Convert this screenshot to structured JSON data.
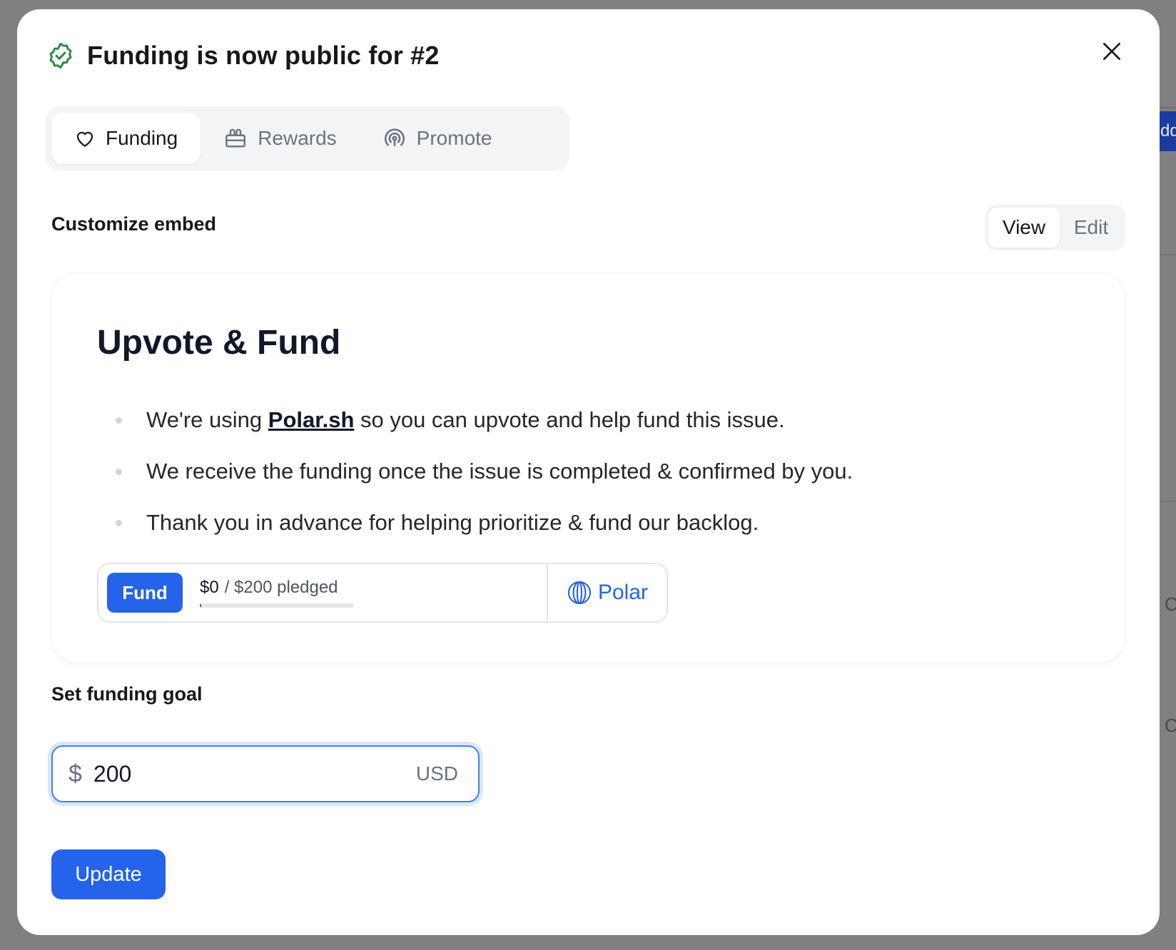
{
  "header": {
    "title": "Funding is now public for #2",
    "status_icon": "check-badge-icon",
    "close_icon": "close-icon"
  },
  "tabs": [
    {
      "label": "Funding",
      "icon": "heart-icon",
      "active": true
    },
    {
      "label": "Rewards",
      "icon": "gift-icon",
      "active": false
    },
    {
      "label": "Promote",
      "icon": "broadcast-icon",
      "active": false
    }
  ],
  "embed": {
    "section_title": "Customize embed",
    "toggle": {
      "view_label": "View",
      "edit_label": "Edit",
      "selected": "View"
    },
    "preview": {
      "heading": "Upvote & Fund",
      "bullet1_pre": "We're using ",
      "bullet1_link": "Polar.sh",
      "bullet1_post": " so you can upvote and help fund this issue.",
      "bullet2": "We receive the funding once the issue is completed & confirmed by you.",
      "bullet3": "Thank you in advance for helping prioritize & fund our backlog."
    },
    "badge": {
      "fund_label": "Fund",
      "pledged_amount": "$0",
      "pledge_goal_text": "/ $200 pledged",
      "progress_fraction": 0,
      "brand_label": "Polar",
      "brand_icon": "polar-logo-icon"
    }
  },
  "goal": {
    "label": "Set funding goal",
    "currency_symbol": "$",
    "value": "200",
    "currency_code": "USD"
  },
  "actions": {
    "update_label": "Update"
  },
  "colors": {
    "accent": "#2563eb",
    "success": "#2e8b3e"
  },
  "background": {
    "button_fragment": "dd",
    "glyph": "C"
  }
}
